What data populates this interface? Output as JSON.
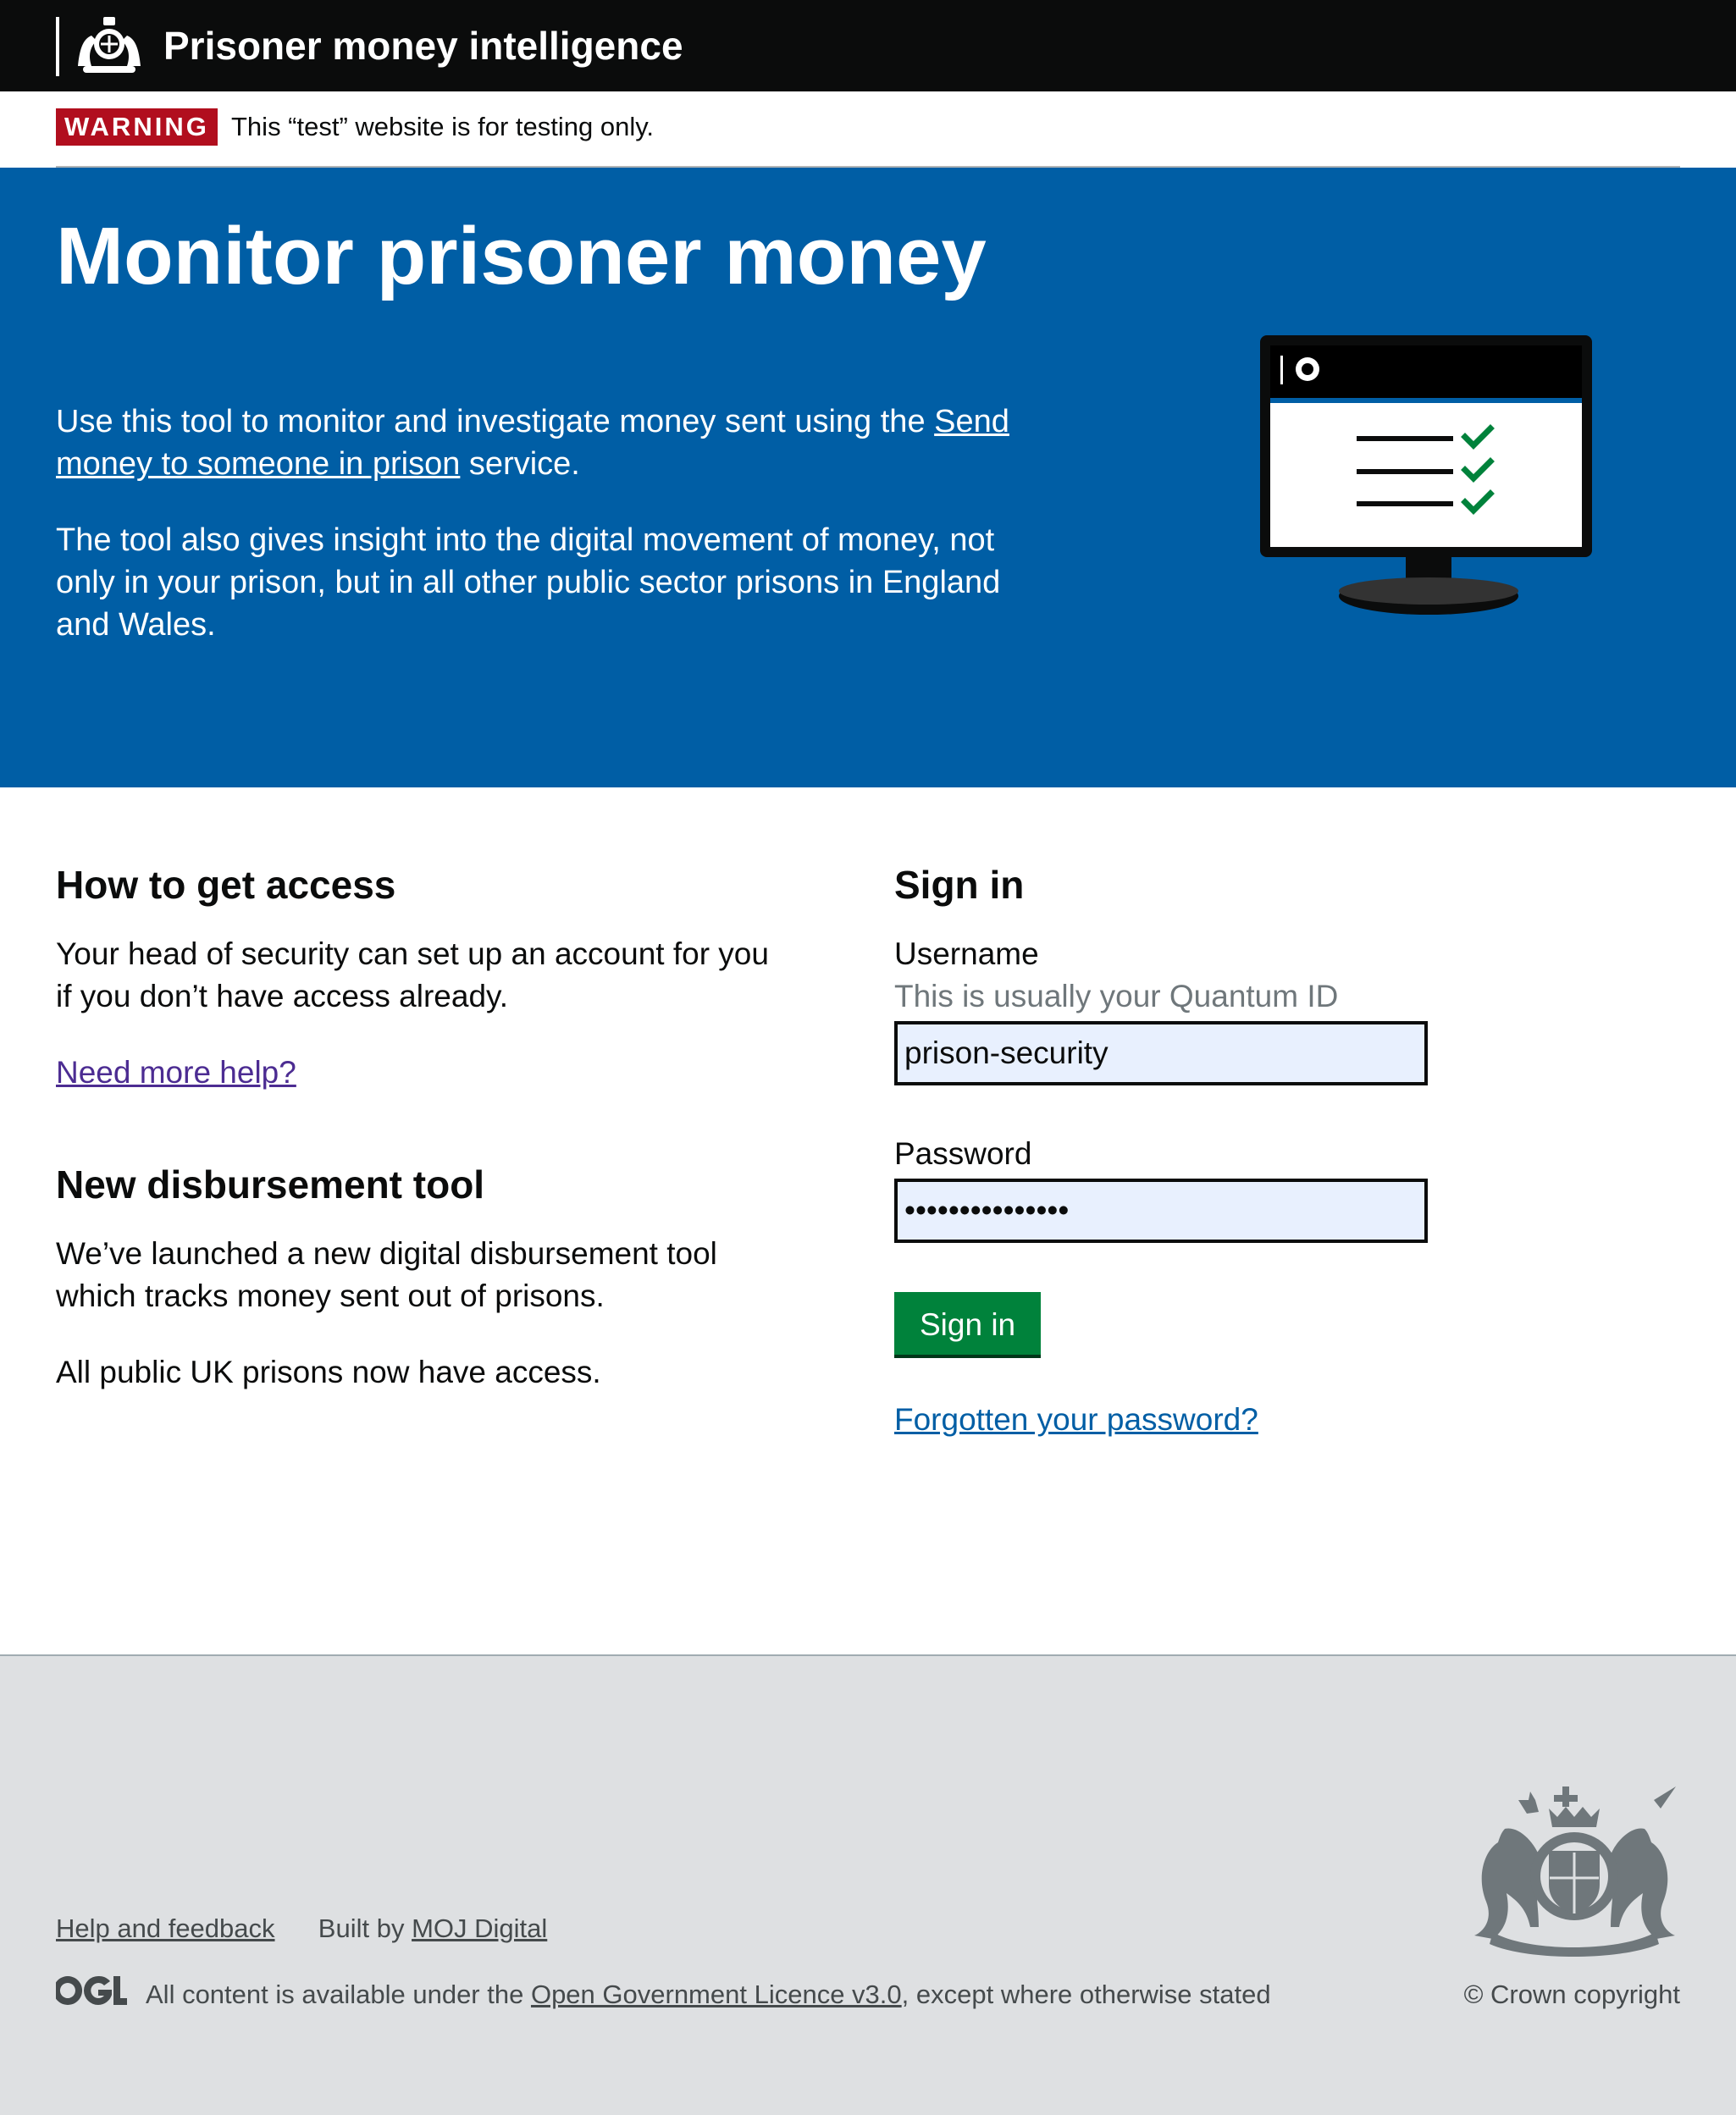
{
  "header": {
    "service_name": "Prisoner money intelligence",
    "crest_icon": "royal-coat-of-arms-icon"
  },
  "phase_banner": {
    "tag": "WARNING",
    "message": "This “test” website is for testing only."
  },
  "hero": {
    "title": "Monitor prisoner money",
    "intro_before_link": "Use this tool to monitor and investigate money sent using the ",
    "intro_link": "Send money to someone in prison",
    "intro_after_link": " service.",
    "paragraph2": "The tool also gives insight into the digital movement of money, not only in your prison, but in all other public sector prisons in England and Wales.",
    "illustration_icon": "monitor-checklist-icon"
  },
  "access": {
    "heading": "How to get access",
    "body": "Your head of security can set up an account for you if you don’t have access already.",
    "help_link": "Need more help?"
  },
  "disbursement": {
    "heading": "New disbursement tool",
    "body": "We’ve launched a new digital disbursement tool which tracks money sent out of prisons.",
    "body2": "All public UK prisons now have access."
  },
  "sign_in": {
    "heading": "Sign in",
    "username_label": "Username",
    "username_hint": "This is usually your Quantum ID",
    "username_value": "prison-security",
    "password_label": "Password",
    "password_value": "•••••••••••••••",
    "button": "Sign in",
    "forgot_link": "Forgotten your password?"
  },
  "footer": {
    "help_link": "Help and feedback",
    "built_by": "Built by ",
    "built_by_link": "MOJ Digital",
    "licence_before": "All content is available under the ",
    "licence_link": "Open Government Licence v3.0",
    "licence_after": ", except where otherwise stated",
    "copyright": "© Crown copyright",
    "ogl_icon": "ogl-logo-icon",
    "crest_icon": "royal-coat-of-arms-icon"
  },
  "colors": {
    "header_bg": "#0b0c0c",
    "hero_bg": "#005ea5",
    "warning_tag": "#b10e1e",
    "button_bg": "#00823b",
    "footer_bg": "#dee0e2",
    "link_visited": "#4c2c92",
    "link": "#005ea5"
  }
}
